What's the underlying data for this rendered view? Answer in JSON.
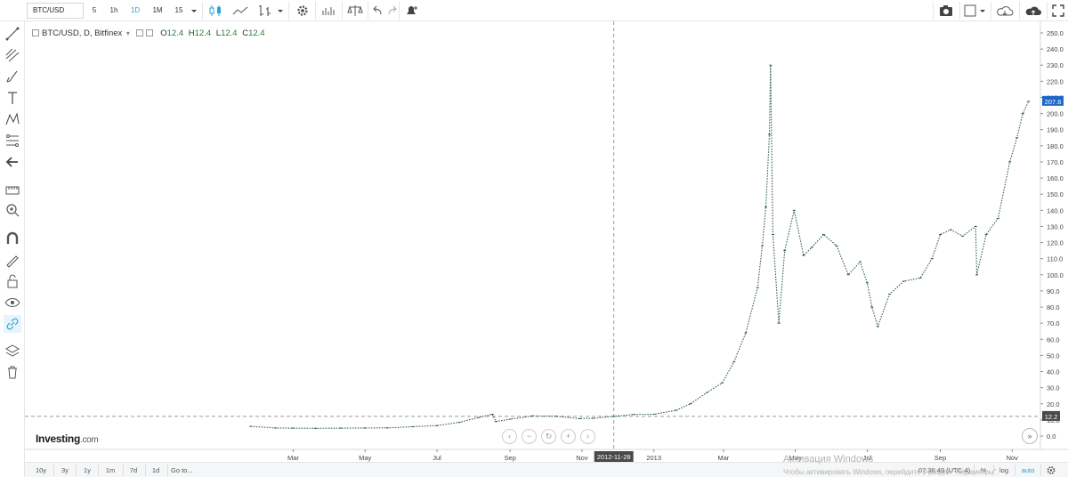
{
  "toolbar": {
    "symbol": "BTC/USD",
    "intervals": [
      "5",
      "1h",
      "1D",
      "1M",
      "15"
    ],
    "active_interval": "1D"
  },
  "legend": {
    "title": "BTC/USD, D, Bitfinex",
    "o_label": "O",
    "o_value": "12.4",
    "h_label": "H",
    "h_value": "12.4",
    "l_label": "L",
    "l_value": "12.4",
    "c_label": "C",
    "c_value": "12.4"
  },
  "logo": {
    "brand": "Investing",
    "suffix": ".com"
  },
  "bottombar": {
    "ranges": [
      "10y",
      "3y",
      "1y",
      "1m",
      "7d",
      "1d"
    ],
    "goto": "Go to...",
    "time": "07:36:49 (UTC-4)",
    "percent": "%",
    "log": "log",
    "auto": "auto"
  },
  "watermark": {
    "line1": "Активация Windows",
    "line2": "Чтобы активировать Windows, перейдите в раздел \"Параметры\"."
  },
  "colors": {
    "price_line": "#2f5d3f",
    "crosshair": "#9a9a9a",
    "last_price_badge": "#1e66c8",
    "crosshair_label": "#4a4a4a",
    "accent": "#27a3d6"
  },
  "chart_data": {
    "type": "line",
    "title": "BTC/USD, D, Bitfinex",
    "xlabel": "",
    "ylabel": "",
    "ylim": [
      0,
      255
    ],
    "x_ticks": [
      "Mar",
      "May",
      "Jul",
      "Sep",
      "Nov",
      "2012-11-28",
      "2013",
      "Mar",
      "May",
      "Jul",
      "Sep",
      "Nov"
    ],
    "y_ticks": [
      0,
      10,
      20,
      30,
      40,
      50,
      60,
      70,
      80,
      90,
      100,
      110,
      120,
      130,
      140,
      150,
      160,
      170,
      180,
      190,
      200,
      210,
      220,
      230,
      240,
      250
    ],
    "crosshair": {
      "date": "2012-11-28",
      "price": 12.2
    },
    "last_price": 207.6,
    "grid": false,
    "series": [
      {
        "x": [
          "2012-01-25",
          "2012-02-15",
          "2012-03-01",
          "2012-03-20",
          "2012-04-10",
          "2012-05-01",
          "2012-05-20",
          "2012-06-10",
          "2012-07-01",
          "2012-07-20",
          "2012-08-05",
          "2012-08-17",
          "2012-08-20",
          "2012-09-01",
          "2012-09-20",
          "2012-10-10",
          "2012-10-30",
          "2012-11-10",
          "2012-11-28",
          "2012-12-15",
          "2013-01-01",
          "2013-01-20",
          "2013-02-01",
          "2013-02-15",
          "2013-02-28",
          "2013-03-10",
          "2013-03-20",
          "2013-03-30",
          "2013-04-03",
          "2013-04-06",
          "2013-04-09",
          "2013-04-10",
          "2013-04-12",
          "2013-04-17",
          "2013-04-22",
          "2013-04-30",
          "2013-05-08",
          "2013-05-15",
          "2013-05-25",
          "2013-06-05",
          "2013-06-15",
          "2013-06-25",
          "2013-07-01",
          "2013-07-05",
          "2013-07-10",
          "2013-07-20",
          "2013-08-01",
          "2013-08-15",
          "2013-08-25",
          "2013-09-01",
          "2013-09-10",
          "2013-09-20",
          "2013-10-01",
          "2013-10-02",
          "2013-10-10",
          "2013-10-20",
          "2013-10-30",
          "2013-11-05",
          "2013-11-10",
          "2013-11-15"
        ],
        "y": [
          6,
          5,
          4.9,
          4.8,
          4.9,
          5,
          5.1,
          5.8,
          6.5,
          8.5,
          11.5,
          13.5,
          9,
          10.5,
          12.5,
          12.3,
          10.8,
          11,
          12.2,
          13.4,
          13.5,
          16,
          20,
          27,
          33,
          46,
          64,
          92,
          118,
          142,
          187,
          230,
          125,
          70,
          115,
          140,
          112,
          117,
          125,
          118,
          100,
          108,
          95,
          80,
          68,
          88,
          96,
          98,
          110,
          125,
          128,
          124,
          130,
          100,
          125,
          135,
          170,
          185,
          200,
          207.6
        ]
      }
    ]
  }
}
